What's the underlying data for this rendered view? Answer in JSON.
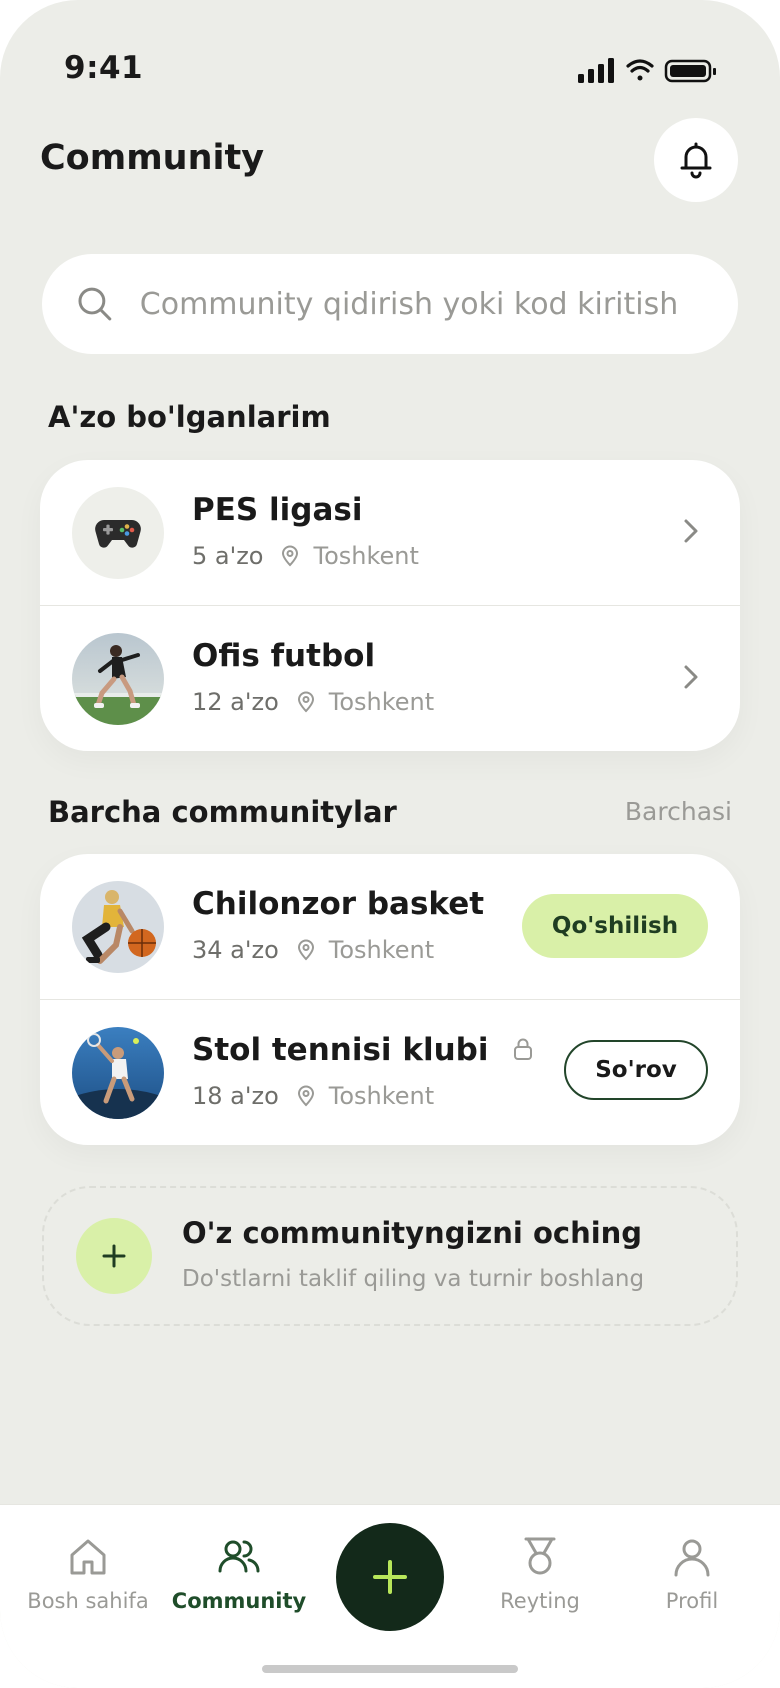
{
  "status_bar": {
    "time": "9:41"
  },
  "header": {
    "title": "Community"
  },
  "search": {
    "placeholder": "Community qidirish yoki kod kiritish"
  },
  "my_communities": {
    "title": "A'zo bo'lganlarim",
    "items": [
      {
        "name": "PES ligasi",
        "members": "5 a'zo",
        "location": "Toshkent",
        "avatar_icon": "gamepad-icon"
      },
      {
        "name": "Ofis futbol",
        "members": "12 a'zo",
        "location": "Toshkent",
        "avatar_icon": "football-player-photo"
      }
    ]
  },
  "all_communities": {
    "title": "Barcha communitylar",
    "see_all": "Barchasi",
    "items": [
      {
        "name": "Chilonzor basket",
        "members": "34 a'zo",
        "location": "Toshkent",
        "action": "Qo'shilish",
        "locked": false
      },
      {
        "name": "Stol tennisi klubi",
        "members": "18 a'zo",
        "location": "Toshkent",
        "action": "So'rov",
        "locked": true
      }
    ]
  },
  "create": {
    "title": "O'z communityngizni oching",
    "subtitle": "Do'stlarni taklif qiling va turnir boshlang"
  },
  "tabbar": {
    "items": [
      {
        "label": "Bosh sahifa",
        "icon": "home-icon",
        "active": false
      },
      {
        "label": "Community",
        "icon": "users-icon",
        "active": true
      },
      {
        "label": "Reyting",
        "icon": "medal-icon",
        "active": false
      },
      {
        "label": "Profil",
        "icon": "user-icon",
        "active": false
      }
    ]
  },
  "colors": {
    "background": "#ECEDE8",
    "accent_light": "#D9F0A8",
    "accent_dark": "#13291A",
    "active_tab": "#1f4d2a"
  }
}
